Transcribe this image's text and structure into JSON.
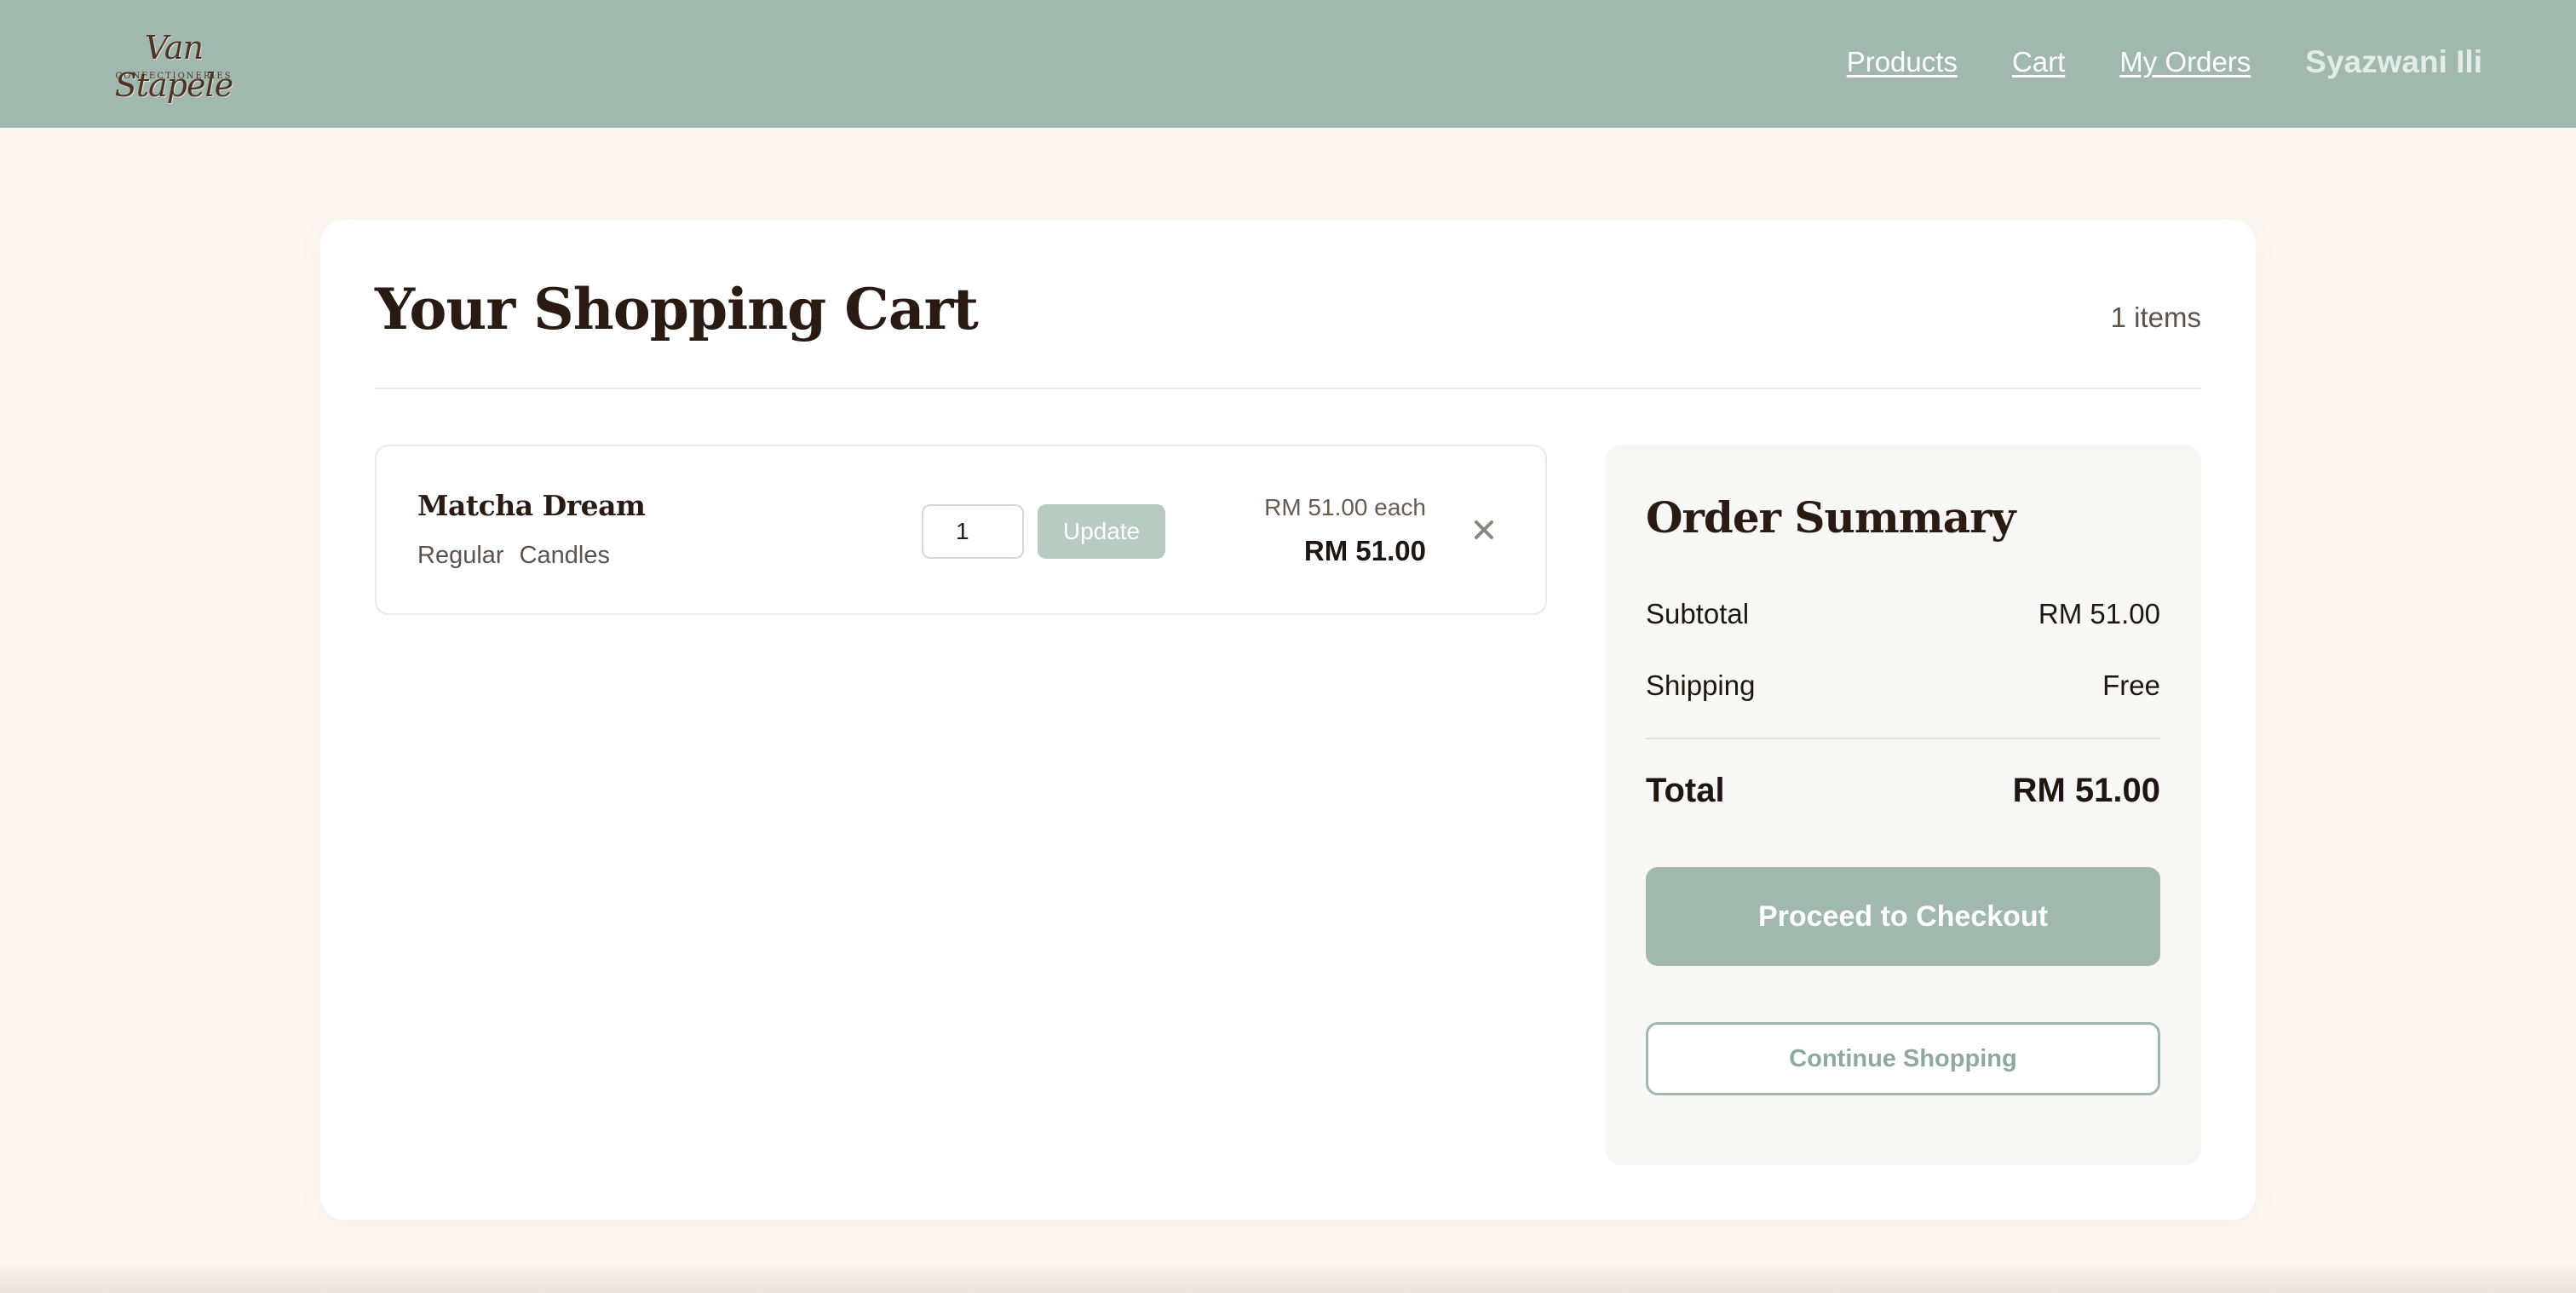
{
  "brand": {
    "logo_text": "Van Stapele",
    "logo_subtext": "CONFECTIONERIES"
  },
  "nav": {
    "products": "Products",
    "cart": "Cart",
    "my_orders": "My Orders",
    "user_name": "Syazwani Ili"
  },
  "cart": {
    "title": "Your Shopping Cart",
    "items_count": "1 items",
    "items": [
      {
        "name": "Matcha Dream",
        "size": "Regular",
        "category": "Candles",
        "quantity": "1",
        "update_label": "Update",
        "unit_price": "RM 51.00 each",
        "line_total": "RM 51.00",
        "remove_icon": "close-icon"
      }
    ]
  },
  "summary": {
    "title": "Order Summary",
    "subtotal_label": "Subtotal",
    "subtotal_value": "RM 51.00",
    "shipping_label": "Shipping",
    "shipping_value": "Free",
    "total_label": "Total",
    "total_value": "RM 51.00",
    "checkout_label": "Proceed to Checkout",
    "continue_label": "Continue Shopping"
  },
  "colors": {
    "header_bg": "#a0b8ae",
    "page_bg": "#fdf7f2",
    "accent": "#a0b8ae",
    "update_button": "#b8cbc3",
    "heading_text": "#2a1a14"
  }
}
